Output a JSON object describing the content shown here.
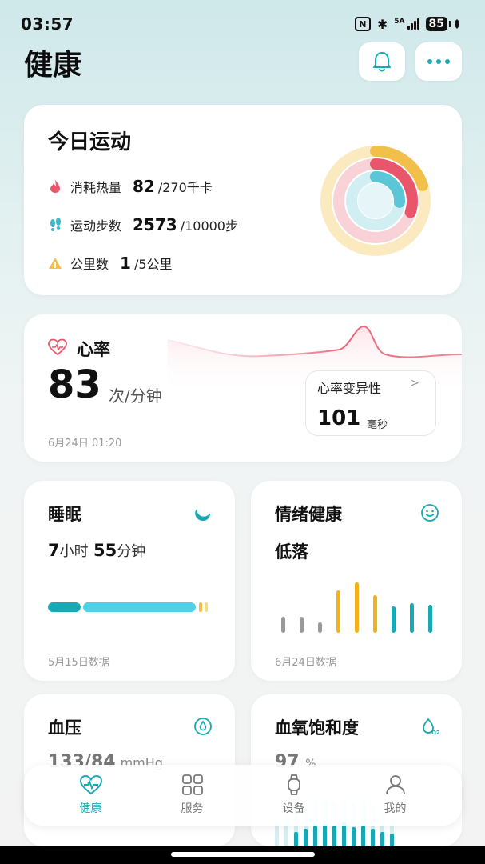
{
  "status": {
    "time": "03:57",
    "nfc": "N",
    "bluetooth": "✱",
    "network": "5A",
    "battery": "85"
  },
  "header": {
    "title": "健康"
  },
  "activity": {
    "title": "今日运动",
    "rows": [
      {
        "label": "消耗热量",
        "value": "82",
        "goal": "/270千卡"
      },
      {
        "label": "运动步数",
        "value": "2573",
        "goal": "/10000步"
      },
      {
        "label": "公里数",
        "value": "1",
        "goal": "/5公里"
      }
    ],
    "ring_progress": {
      "calories": 0.3,
      "steps": 0.26,
      "distance": 0.2
    },
    "colors": {
      "calories": "#e9566b",
      "steps": "#5bc6d6",
      "distance": "#f2c04a"
    }
  },
  "heart": {
    "title": "心率",
    "value": "83",
    "unit": "次/分钟",
    "date": "6月24日 01:20",
    "hrv_title": "心率变异性",
    "hrv_arrow": ">",
    "hrv_value": "101",
    "hrv_unit": "毫秒"
  },
  "sleep": {
    "title": "睡眠",
    "hours": "7",
    "hours_unit": "小时",
    "minutes": "55",
    "minutes_unit": "分钟",
    "date": "5月15日数据"
  },
  "mood": {
    "title": "情绪健康",
    "value": "低落",
    "date": "6月24日数据"
  },
  "bp": {
    "title": "血压",
    "value": "133/84",
    "unit": "mmHg"
  },
  "spo2": {
    "title": "血氧饱和度",
    "value": "97",
    "unit": "%"
  },
  "nav": [
    {
      "label": "健康"
    },
    {
      "label": "服务"
    },
    {
      "label": "设备"
    },
    {
      "label": "我的"
    }
  ]
}
